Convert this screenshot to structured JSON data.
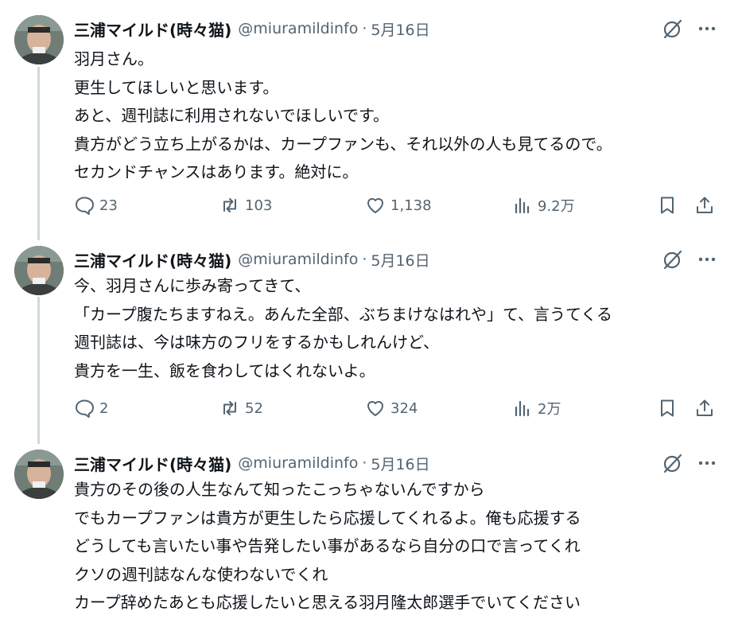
{
  "tweets": [
    {
      "author": {
        "name": "三浦マイルド(時々猫)",
        "handle": "@miuramildinfo",
        "date": "5月16日"
      },
      "lines": [
        "羽月さん。",
        "更生してほしいと思います。",
        "あと、週刊誌に利用されないでほしいです。",
        "貴方がどう立ち上がるかは、カープファンも、それ以外の人も見てるので。",
        "セカンドチャンスはあります。絶対に。"
      ],
      "stats": {
        "replies": "23",
        "reposts": "103",
        "likes": "1,138",
        "views": "9.2万"
      }
    },
    {
      "author": {
        "name": "三浦マイルド(時々猫)",
        "handle": "@miuramildinfo",
        "date": "5月16日"
      },
      "lines": [
        "今、羽月さんに歩み寄ってきて、",
        "「カープ腹たちますねえ。あんた全部、ぶちまけなはれや」て、言うてくる",
        "週刊誌は、今は味方のフリをするかもしれんけど、",
        "貴方を一生、飯を食わしてはくれないよ。"
      ],
      "stats": {
        "replies": "2",
        "reposts": "52",
        "likes": "324",
        "views": "2万"
      }
    },
    {
      "author": {
        "name": "三浦マイルド(時々猫)",
        "handle": "@miuramildinfo",
        "date": "5月16日"
      },
      "lines": [
        "貴方のその後の人生なんて知ったこっちゃないんですから",
        "でもカープファンは貴方が更生したら応援してくれるよ。俺も応援する",
        "どうしても言いたい事や告発したい事があるなら自分の口で言ってくれ",
        "クソの週刊誌なんな使わないでくれ",
        "カープ辞めたあとも応援したいと思える羽月隆太郎選手でいてください"
      ]
    }
  ],
  "icons": {
    "reply": "reply-icon",
    "repost": "repost-icon",
    "like": "heart-icon",
    "views": "views-icon",
    "bookmark": "bookmark-icon",
    "share": "share-icon",
    "grok": "grok-icon",
    "more": "more-icon"
  },
  "colors": {
    "text": "#0f1419",
    "secondary": "#536471",
    "thread_line": "#cfd9de"
  }
}
